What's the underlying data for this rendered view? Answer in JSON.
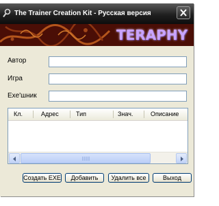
{
  "window": {
    "title": "The Trainer Creation Kit - Русская версия"
  },
  "banner": {
    "title": "TERAPHY"
  },
  "fields": {
    "author": {
      "label": "Автор",
      "value": ""
    },
    "game": {
      "label": "Игра",
      "value": ""
    },
    "exe": {
      "label": "Exe'шник",
      "value": ""
    }
  },
  "list": {
    "columns": [
      "Кл.",
      "Адрес",
      "Тип",
      "Знач.",
      "Описание"
    ],
    "rows": []
  },
  "buttons": {
    "create_exe": "Создать EXE",
    "add": "Добавить",
    "delete_all": "Удалить все",
    "exit": "Выход"
  },
  "icons": {
    "app": "magnifier-icon",
    "close": "close-icon",
    "scroll_left": "arrow-left-icon",
    "scroll_right": "arrow-right-icon",
    "grip": "scroll-grip-icon"
  },
  "colors": {
    "titlebar": "#1f1f1f",
    "banner_bg": "#4a0e06",
    "banner_text": "#c9a3ff",
    "button_border": "#003c74"
  }
}
